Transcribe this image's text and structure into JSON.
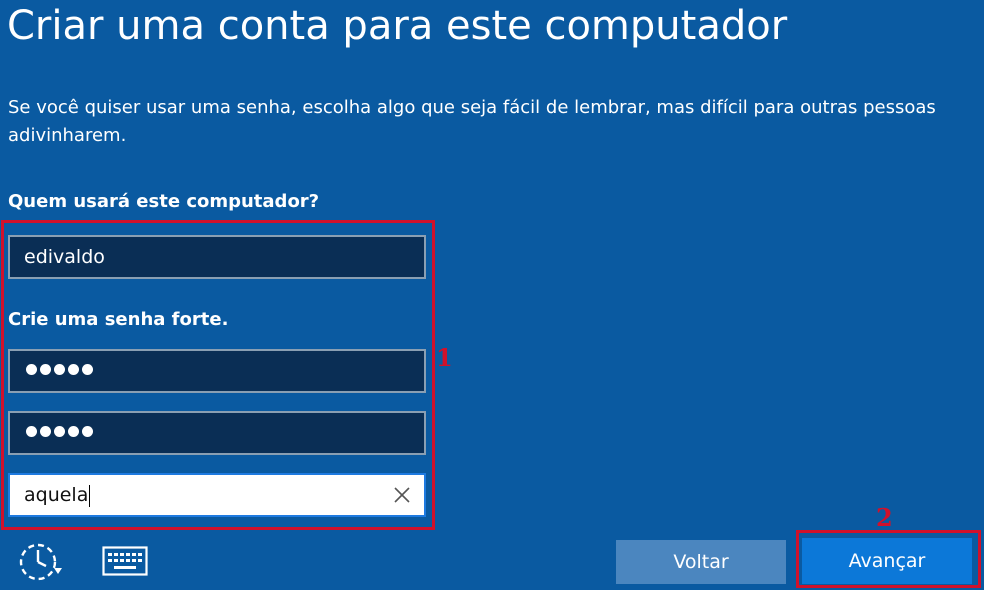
{
  "page": {
    "title": "Criar uma conta para este computador",
    "description": "Se você quiser usar uma senha, escolha algo que seja fácil de lembrar, mas difícil para outras pessoas adivinharem."
  },
  "form": {
    "user_label": "Quem usará este computador?",
    "username_value": "edivaldo",
    "password_label": "Crie uma senha forte.",
    "password_value_masked": "•••••",
    "confirm_password_value_masked": "•••••",
    "hint_value": "aquela"
  },
  "buttons": {
    "back_label": "Voltar",
    "next_label": "Avançar"
  },
  "annotations": {
    "marker_1": "1",
    "marker_2": "2",
    "color": "#d0112b"
  },
  "icons": {
    "accessibility": "ease-of-access-icon",
    "keyboard": "keyboard-icon",
    "clear": "clear-x-icon"
  },
  "colors": {
    "background": "#0a5aa1",
    "field_background": "#0a2e55",
    "next_button": "#0c78d8",
    "back_button": "#4b86bf"
  }
}
